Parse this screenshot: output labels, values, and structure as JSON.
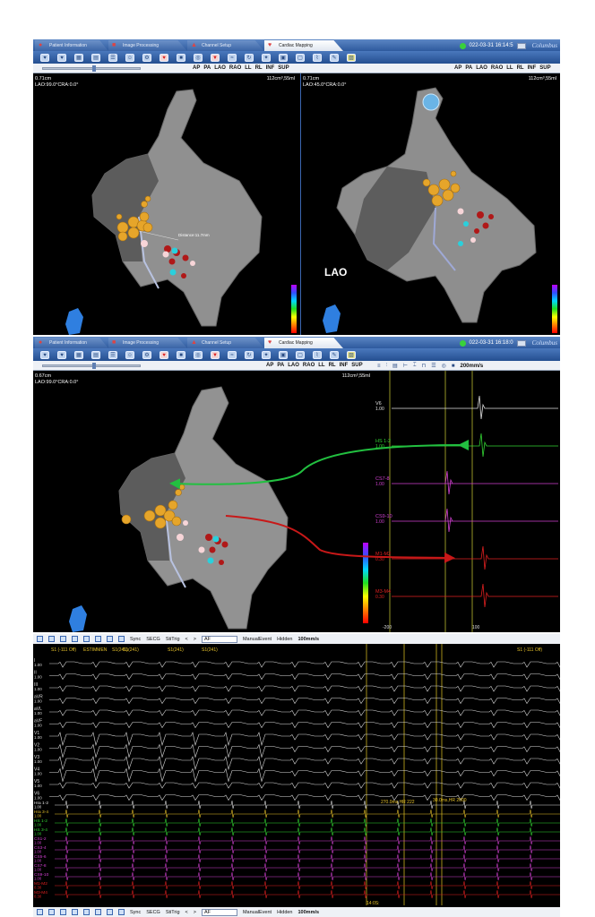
{
  "tabs": [
    {
      "label": "Patient Information",
      "icon": "patient-icon"
    },
    {
      "label": "Image Processing",
      "icon": "image-icon"
    },
    {
      "label": "Channel Setup",
      "icon": "channel-icon"
    },
    {
      "label": "Cardiac Mapping",
      "icon": "heart-icon"
    }
  ],
  "panel_a": {
    "datetime": "022-03-31 16:14:5",
    "brand": "Columbus",
    "view_buttons": [
      "AP",
      "PA",
      "LAO",
      "RAO",
      "LL",
      "RL",
      "INF",
      "SUP"
    ],
    "left_view": {
      "scale": "0.71cm",
      "orientation": "LAO:99.0°CRA:0.0°",
      "volume": "112cm³,55ml",
      "distance_label": "Distance:11.7mm"
    },
    "right_view": {
      "scale": "0.71cm",
      "orientation": "LAO:45.0°CRA:0.0°",
      "volume": "112cm³,55ml",
      "projection_label": "LAO"
    }
  },
  "panel_b": {
    "datetime": "022-03-31 16:18:0",
    "brand": "Columbus",
    "view_buttons": [
      "AP",
      "PA",
      "LAO",
      "RAO",
      "LL",
      "RL",
      "INF",
      "SUP"
    ],
    "view": {
      "scale": "0.67cm",
      "orientation": "LAO:99.0°CRA:0.0°",
      "volume": "112cm³,55ml"
    },
    "speed": "200mm/s",
    "channels": [
      {
        "label": "V6",
        "gain": "1.00",
        "color": "#e0e0e0"
      },
      {
        "label": "HS 1-2",
        "gain": "1.00",
        "color": "#33d633"
      },
      {
        "label": "CS7-8",
        "gain": "1.00",
        "color": "#d040d0"
      },
      {
        "label": "CS9-10",
        "gain": "1.00",
        "color": "#d040d0"
      },
      {
        "label": "M1-M2",
        "gain": "0.30",
        "color": "#e02020"
      },
      {
        "label": "M3-M4",
        "gain": "0.30",
        "color": "#e02020"
      }
    ],
    "axis_ticks": [
      "-200",
      "100"
    ]
  },
  "panel_c": {
    "toolbar": {
      "sync": "Sync",
      "secg": "SECG",
      "stitrig": "StiTrig",
      "rhythm": "AF",
      "manual_event": "ManualEvent",
      "hidden": "Hidden",
      "speed": "100mm/s"
    },
    "markers": [
      "S1 (-111 Off)",
      "S1(241)",
      "S1(241)",
      "S1(241)",
      "S1(241)",
      "S1 (-111 Off)"
    ],
    "marker_event": "ESTIMMEN",
    "measurements": [
      {
        "text": "270.0ms,HR 222"
      },
      {
        "text": "30.0ms,HR 2000"
      }
    ],
    "surface_leads": [
      {
        "label": "I",
        "gain": "1.00"
      },
      {
        "label": "II",
        "gain": "1.00"
      },
      {
        "label": "III",
        "gain": "1.00"
      },
      {
        "label": "aVR",
        "gain": "1.00"
      },
      {
        "label": "aVL",
        "gain": "1.00"
      },
      {
        "label": "aVF",
        "gain": "1.00"
      },
      {
        "label": "V1",
        "gain": "1.00"
      },
      {
        "label": "V2",
        "gain": "1.00"
      },
      {
        "label": "V3",
        "gain": "1.00"
      },
      {
        "label": "V4",
        "gain": "1.00"
      },
      {
        "label": "V5",
        "gain": "1.00"
      },
      {
        "label": "V6",
        "gain": "1.00"
      }
    ],
    "intracardiac_leads": [
      {
        "label": "Hra 1-2",
        "gain": "1.00",
        "color": "#e0e0e0"
      },
      {
        "label": "Hra 3-4",
        "gain": "1.00",
        "color": "#e6c12a"
      },
      {
        "label": "HS 1-2",
        "gain": "1.00",
        "color": "#33d633"
      },
      {
        "label": "HS 3-4",
        "gain": "1.00",
        "color": "#33d633"
      },
      {
        "label": "CS1-2",
        "gain": "1.00",
        "color": "#d040d0"
      },
      {
        "label": "CS3-4",
        "gain": "1.00",
        "color": "#d040d0"
      },
      {
        "label": "CS5-6",
        "gain": "1.00",
        "color": "#d040d0"
      },
      {
        "label": "CS7-8",
        "gain": "1.00",
        "color": "#d040d0"
      },
      {
        "label": "CS9-10",
        "gain": "1.00",
        "color": "#d040d0"
      },
      {
        "label": "M1-M2",
        "gain": "0.30",
        "color": "#e02020"
      },
      {
        "label": "M3-M4",
        "gain": "0.30",
        "color": "#e02020"
      }
    ],
    "time_label": "14:0S:"
  }
}
